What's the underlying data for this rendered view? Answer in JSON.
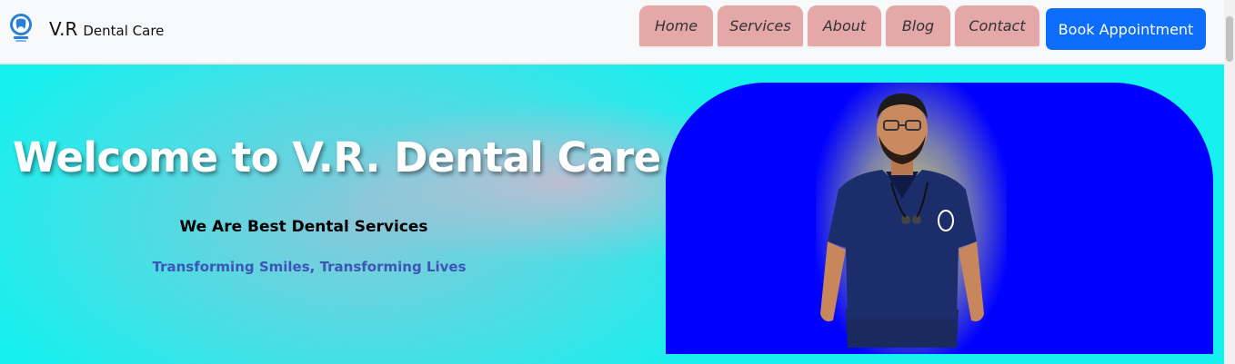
{
  "brand": {
    "name": "V.R",
    "subtitle": "Dental Care",
    "logo_icon": "tooth-logo-icon"
  },
  "nav": {
    "items": [
      {
        "label": "Home"
      },
      {
        "label": "Services"
      },
      {
        "label": "About"
      },
      {
        "label": "Blog"
      },
      {
        "label": "Contact"
      }
    ],
    "cta_label": "Book Appointment"
  },
  "hero": {
    "title": "Welcome to V.R. Dental Care",
    "subtitle": "We Are Best Dental Services",
    "tagline": "Transforming Smiles, Transforming Lives",
    "image_icon": "doctor-photo"
  },
  "colors": {
    "nav_link_bg": "#e5a8a8",
    "cta_bg": "#0d6efd",
    "hero_bg": "#16f0ee",
    "photo_bg": "#0000ff",
    "tagline": "#3d55b5"
  }
}
